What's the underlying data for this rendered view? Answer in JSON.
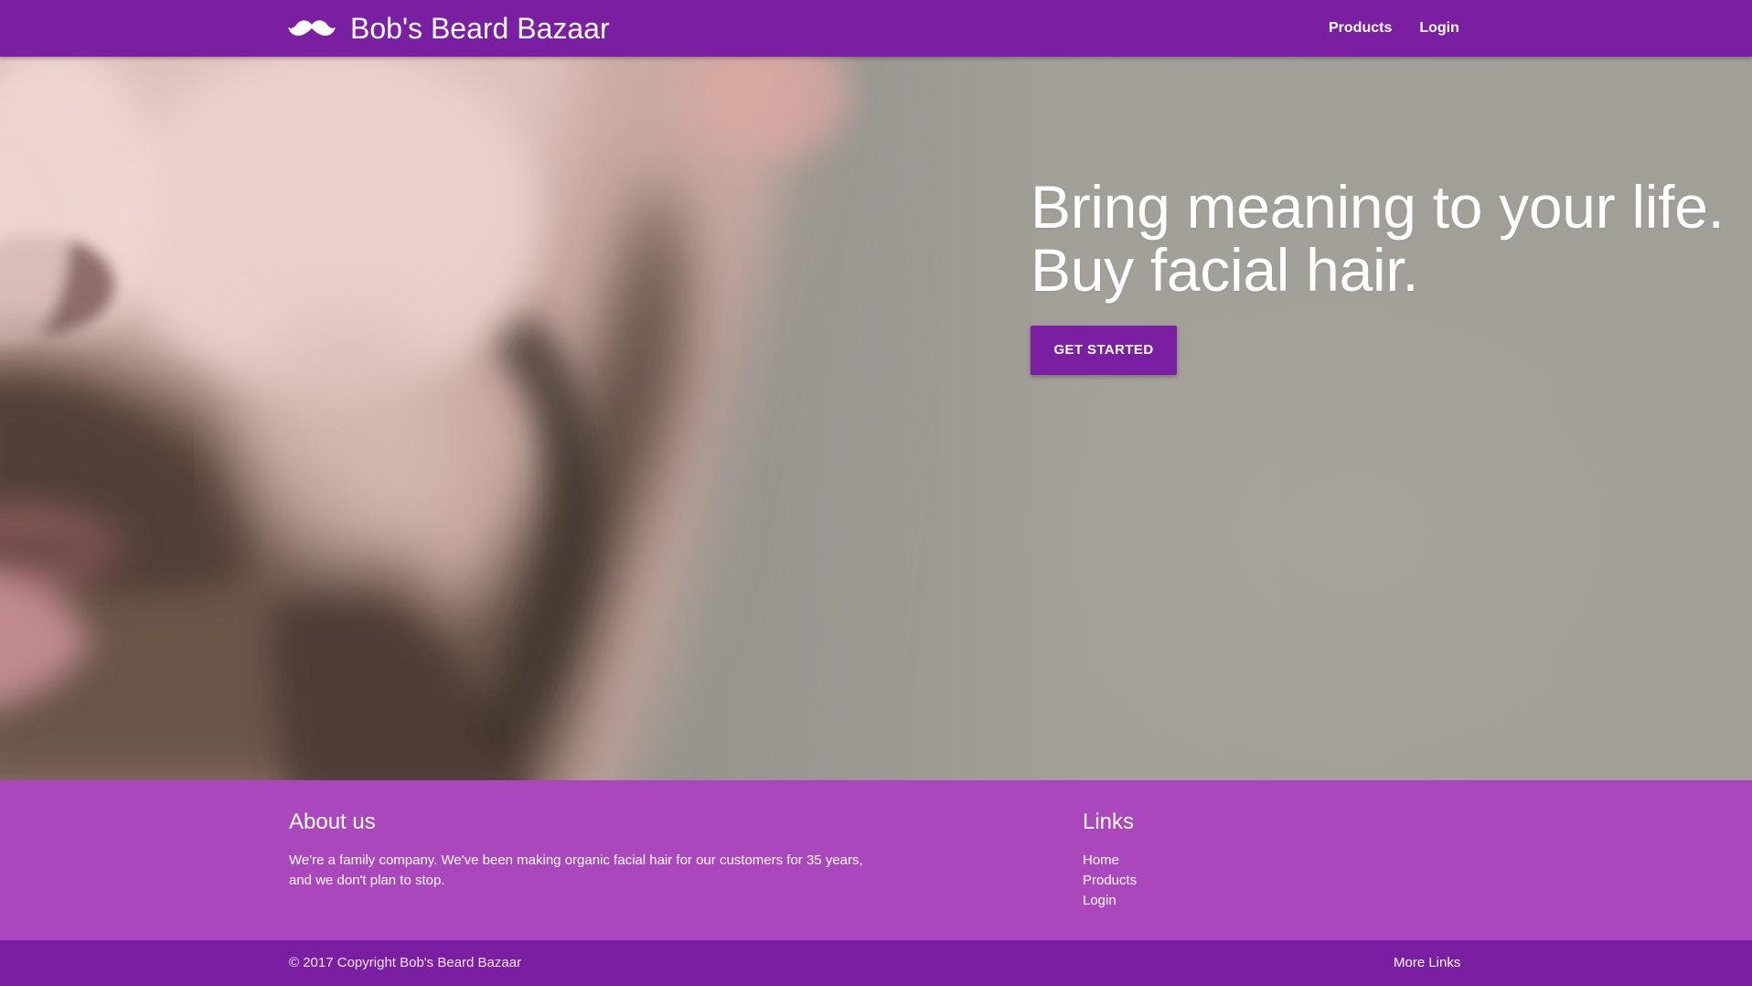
{
  "navbar": {
    "brand_name": "Bob's Beard Bazaar",
    "brand_icon": "mustache-icon",
    "links": [
      {
        "label": "Products"
      },
      {
        "label": "Login"
      }
    ]
  },
  "hero": {
    "heading_line1": "Bring meaning to your life.",
    "heading_line2": "Buy facial hair.",
    "button_label": "GET STARTED",
    "background_image": "close-up of bearded face"
  },
  "footer": {
    "about": {
      "heading": "About us",
      "text": "We're a family company. We've been making organic facial hair for our customers for 35 years, and we don't plan to stop."
    },
    "links": {
      "heading": "Links",
      "items": [
        {
          "label": "Home"
        },
        {
          "label": "Products"
        },
        {
          "label": "Login"
        }
      ]
    },
    "copyright": "© 2017 Copyright Bob's Beard Bazaar",
    "more_links": "More Links"
  },
  "colors": {
    "primary": "#7b1fa2",
    "footer": "#ab47bc",
    "text": "#ffffff"
  }
}
